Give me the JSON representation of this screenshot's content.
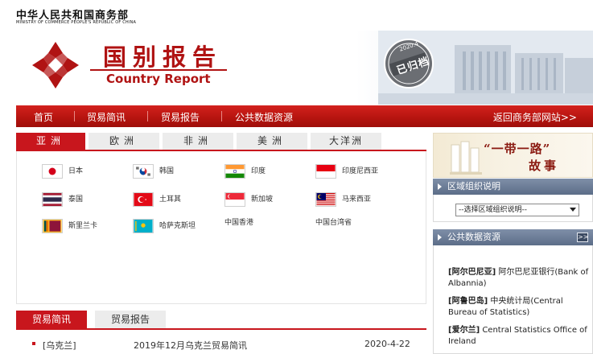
{
  "brand": {
    "name_cn": "中华人民共和国商务部",
    "name_en": "MINISTRY OF COMMERCE PEOPLE'S REPUBLIC OF CHINA"
  },
  "banner": {
    "title_cn": "国别报告",
    "title_en": "Country Report",
    "stamp_year": "2020.4",
    "stamp_text": "已归档"
  },
  "nav": {
    "items": [
      "首页",
      "贸易简讯",
      "贸易报告",
      "公共数据资源"
    ],
    "back_link": "返回商务部网站>>"
  },
  "continents": {
    "tabs": [
      "亚洲",
      "欧洲",
      "非洲",
      "美洲",
      "大洋洲"
    ],
    "active": "亚洲"
  },
  "countries": [
    {
      "name": "日本",
      "flag": "japan"
    },
    {
      "name": "韩国",
      "flag": "korea"
    },
    {
      "name": "印度",
      "flag": "india"
    },
    {
      "name": "印度尼西亚",
      "flag": "indonesia"
    },
    {
      "name": "泰国",
      "flag": "thailand"
    },
    {
      "name": "土耳其",
      "flag": "turkey"
    },
    {
      "name": "新加坡",
      "flag": "singapore"
    },
    {
      "name": "马来西亚",
      "flag": "malaysia"
    },
    {
      "name": "斯里兰卡",
      "flag": "srilanka"
    },
    {
      "name": "哈萨克斯坦",
      "flag": "kazakhstan"
    },
    {
      "name": "中国香港",
      "flag": ""
    },
    {
      "name": "中国台湾省",
      "flag": ""
    }
  ],
  "news": {
    "tabs": [
      "贸易简讯",
      "贸易报告"
    ],
    "active": "贸易简讯",
    "rows": [
      {
        "tag": "[乌克兰]",
        "title": "2019年12月乌克兰贸易简讯",
        "date": "2020-4-22"
      }
    ]
  },
  "belt_road": {
    "line1": "“一带一路”",
    "line2": "故事"
  },
  "region_info": {
    "heading": "区域组织说明",
    "select_value": "--选择区域组织说明--"
  },
  "public_data": {
    "heading": "公共数据资源",
    "more_label": ">>",
    "items": [
      {
        "tag": "[阿尔巴尼亚]",
        "text": "阿尔巴尼亚银行(Bank of Albannia)"
      },
      {
        "tag": "[阿鲁巴岛]",
        "text": "中央统计局(Central Bureau of Statistics)"
      },
      {
        "tag": "[爱尔兰]",
        "text": "Central Statistics Office of Ireland"
      }
    ]
  },
  "colors": {
    "brand_red": "#c8161d",
    "nav_red": "#b5140f",
    "sidebar_head": "#5c6d88"
  }
}
